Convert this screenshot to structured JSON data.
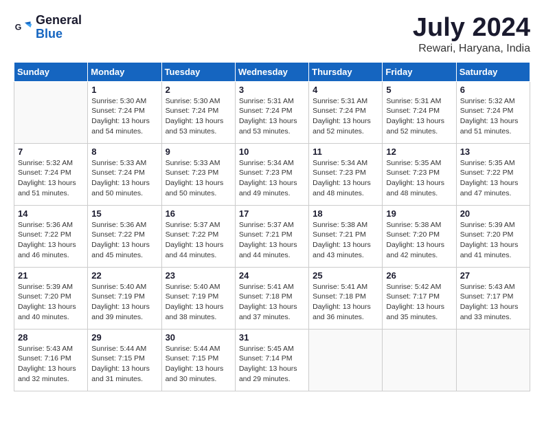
{
  "header": {
    "logo_general": "General",
    "logo_blue": "Blue",
    "month_title": "July 2024",
    "location": "Rewari, Haryana, India"
  },
  "weekdays": [
    "Sunday",
    "Monday",
    "Tuesday",
    "Wednesday",
    "Thursday",
    "Friday",
    "Saturday"
  ],
  "weeks": [
    [
      {
        "day": "",
        "info": ""
      },
      {
        "day": "1",
        "info": "Sunrise: 5:30 AM\nSunset: 7:24 PM\nDaylight: 13 hours\nand 54 minutes."
      },
      {
        "day": "2",
        "info": "Sunrise: 5:30 AM\nSunset: 7:24 PM\nDaylight: 13 hours\nand 53 minutes."
      },
      {
        "day": "3",
        "info": "Sunrise: 5:31 AM\nSunset: 7:24 PM\nDaylight: 13 hours\nand 53 minutes."
      },
      {
        "day": "4",
        "info": "Sunrise: 5:31 AM\nSunset: 7:24 PM\nDaylight: 13 hours\nand 52 minutes."
      },
      {
        "day": "5",
        "info": "Sunrise: 5:31 AM\nSunset: 7:24 PM\nDaylight: 13 hours\nand 52 minutes."
      },
      {
        "day": "6",
        "info": "Sunrise: 5:32 AM\nSunset: 7:24 PM\nDaylight: 13 hours\nand 51 minutes."
      }
    ],
    [
      {
        "day": "7",
        "info": "Sunrise: 5:32 AM\nSunset: 7:24 PM\nDaylight: 13 hours\nand 51 minutes."
      },
      {
        "day": "8",
        "info": "Sunrise: 5:33 AM\nSunset: 7:24 PM\nDaylight: 13 hours\nand 50 minutes."
      },
      {
        "day": "9",
        "info": "Sunrise: 5:33 AM\nSunset: 7:23 PM\nDaylight: 13 hours\nand 50 minutes."
      },
      {
        "day": "10",
        "info": "Sunrise: 5:34 AM\nSunset: 7:23 PM\nDaylight: 13 hours\nand 49 minutes."
      },
      {
        "day": "11",
        "info": "Sunrise: 5:34 AM\nSunset: 7:23 PM\nDaylight: 13 hours\nand 48 minutes."
      },
      {
        "day": "12",
        "info": "Sunrise: 5:35 AM\nSunset: 7:23 PM\nDaylight: 13 hours\nand 48 minutes."
      },
      {
        "day": "13",
        "info": "Sunrise: 5:35 AM\nSunset: 7:22 PM\nDaylight: 13 hours\nand 47 minutes."
      }
    ],
    [
      {
        "day": "14",
        "info": "Sunrise: 5:36 AM\nSunset: 7:22 PM\nDaylight: 13 hours\nand 46 minutes."
      },
      {
        "day": "15",
        "info": "Sunrise: 5:36 AM\nSunset: 7:22 PM\nDaylight: 13 hours\nand 45 minutes."
      },
      {
        "day": "16",
        "info": "Sunrise: 5:37 AM\nSunset: 7:22 PM\nDaylight: 13 hours\nand 44 minutes."
      },
      {
        "day": "17",
        "info": "Sunrise: 5:37 AM\nSunset: 7:21 PM\nDaylight: 13 hours\nand 44 minutes."
      },
      {
        "day": "18",
        "info": "Sunrise: 5:38 AM\nSunset: 7:21 PM\nDaylight: 13 hours\nand 43 minutes."
      },
      {
        "day": "19",
        "info": "Sunrise: 5:38 AM\nSunset: 7:20 PM\nDaylight: 13 hours\nand 42 minutes."
      },
      {
        "day": "20",
        "info": "Sunrise: 5:39 AM\nSunset: 7:20 PM\nDaylight: 13 hours\nand 41 minutes."
      }
    ],
    [
      {
        "day": "21",
        "info": "Sunrise: 5:39 AM\nSunset: 7:20 PM\nDaylight: 13 hours\nand 40 minutes."
      },
      {
        "day": "22",
        "info": "Sunrise: 5:40 AM\nSunset: 7:19 PM\nDaylight: 13 hours\nand 39 minutes."
      },
      {
        "day": "23",
        "info": "Sunrise: 5:40 AM\nSunset: 7:19 PM\nDaylight: 13 hours\nand 38 minutes."
      },
      {
        "day": "24",
        "info": "Sunrise: 5:41 AM\nSunset: 7:18 PM\nDaylight: 13 hours\nand 37 minutes."
      },
      {
        "day": "25",
        "info": "Sunrise: 5:41 AM\nSunset: 7:18 PM\nDaylight: 13 hours\nand 36 minutes."
      },
      {
        "day": "26",
        "info": "Sunrise: 5:42 AM\nSunset: 7:17 PM\nDaylight: 13 hours\nand 35 minutes."
      },
      {
        "day": "27",
        "info": "Sunrise: 5:43 AM\nSunset: 7:17 PM\nDaylight: 13 hours\nand 33 minutes."
      }
    ],
    [
      {
        "day": "28",
        "info": "Sunrise: 5:43 AM\nSunset: 7:16 PM\nDaylight: 13 hours\nand 32 minutes."
      },
      {
        "day": "29",
        "info": "Sunrise: 5:44 AM\nSunset: 7:15 PM\nDaylight: 13 hours\nand 31 minutes."
      },
      {
        "day": "30",
        "info": "Sunrise: 5:44 AM\nSunset: 7:15 PM\nDaylight: 13 hours\nand 30 minutes."
      },
      {
        "day": "31",
        "info": "Sunrise: 5:45 AM\nSunset: 7:14 PM\nDaylight: 13 hours\nand 29 minutes."
      },
      {
        "day": "",
        "info": ""
      },
      {
        "day": "",
        "info": ""
      },
      {
        "day": "",
        "info": ""
      }
    ]
  ]
}
